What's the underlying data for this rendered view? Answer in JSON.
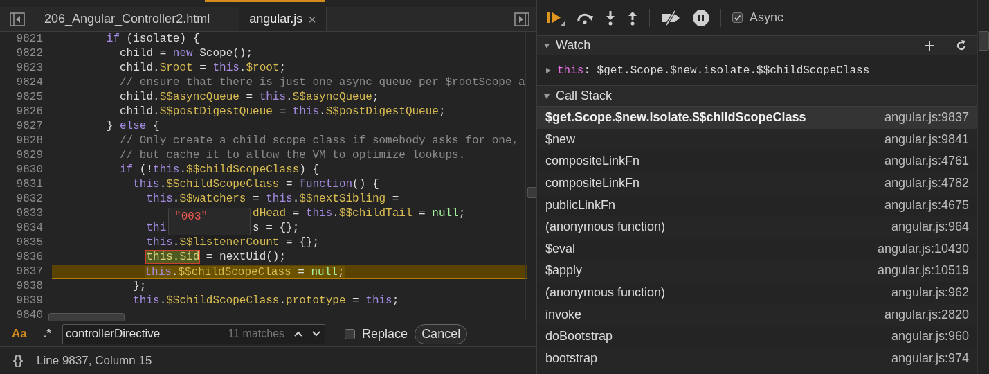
{
  "editor": {
    "tabs": [
      {
        "label": "206_Angular_Controller2.html",
        "selected": false
      },
      {
        "label": "angular.js",
        "close": "×",
        "selected": true
      }
    ],
    "code_lines": [
      {
        "number": "9821",
        "current": false,
        "tokens": [
          {
            "kind": "k",
            "text": "        if"
          },
          {
            "kind": "p",
            "text": " (isolate) {"
          }
        ]
      },
      {
        "number": "9822",
        "current": false,
        "tokens": [
          {
            "kind": "p",
            "text": "          child = "
          },
          {
            "kind": "k",
            "text": "new"
          },
          {
            "kind": "p",
            "text": " Scope();"
          }
        ]
      },
      {
        "number": "9823",
        "current": false,
        "tokens": [
          {
            "kind": "p",
            "text": "          child."
          },
          {
            "kind": "v",
            "text": "$root"
          },
          {
            "kind": "p",
            "text": " = "
          },
          {
            "kind": "k",
            "text": "this"
          },
          {
            "kind": "p",
            "text": "."
          },
          {
            "kind": "v",
            "text": "$root"
          },
          {
            "kind": "p",
            "text": ";"
          }
        ]
      },
      {
        "number": "9824",
        "current": false,
        "tokens": [
          {
            "kind": "c",
            "text": "          // ensure that there is just one async queue per $rootScope a"
          }
        ]
      },
      {
        "number": "9825",
        "current": false,
        "tokens": [
          {
            "kind": "p",
            "text": "          child."
          },
          {
            "kind": "v",
            "text": "$$asyncQueue"
          },
          {
            "kind": "p",
            "text": " = "
          },
          {
            "kind": "k",
            "text": "this"
          },
          {
            "kind": "p",
            "text": "."
          },
          {
            "kind": "v",
            "text": "$$asyncQueue"
          },
          {
            "kind": "p",
            "text": ";"
          }
        ]
      },
      {
        "number": "9826",
        "current": false,
        "tokens": [
          {
            "kind": "p",
            "text": "          child."
          },
          {
            "kind": "v",
            "text": "$$postDigestQueue"
          },
          {
            "kind": "p",
            "text": " = "
          },
          {
            "kind": "k",
            "text": "this"
          },
          {
            "kind": "p",
            "text": "."
          },
          {
            "kind": "v",
            "text": "$$postDigestQueue"
          },
          {
            "kind": "p",
            "text": ";"
          }
        ]
      },
      {
        "number": "9827",
        "current": false,
        "tokens": [
          {
            "kind": "p",
            "text": "        } "
          },
          {
            "kind": "k",
            "text": "else"
          },
          {
            "kind": "p",
            "text": " {"
          }
        ]
      },
      {
        "number": "9828",
        "current": false,
        "tokens": [
          {
            "kind": "c",
            "text": "          // Only create a child scope class if somebody asks for one,"
          }
        ]
      },
      {
        "number": "9829",
        "current": false,
        "tokens": [
          {
            "kind": "c",
            "text": "          // but cache it to allow the VM to optimize lookups."
          }
        ]
      },
      {
        "number": "9830",
        "current": false,
        "tokens": [
          {
            "kind": "k",
            "text": "          if"
          },
          {
            "kind": "p",
            "text": " (!"
          },
          {
            "kind": "k",
            "text": "this"
          },
          {
            "kind": "p",
            "text": "."
          },
          {
            "kind": "v",
            "text": "$$childScopeClass"
          },
          {
            "kind": "p",
            "text": ") {"
          }
        ]
      },
      {
        "number": "9831",
        "current": false,
        "tokens": [
          {
            "kind": "k",
            "text": "            this"
          },
          {
            "kind": "p",
            "text": "."
          },
          {
            "kind": "v",
            "text": "$$childScopeClass"
          },
          {
            "kind": "p",
            "text": " = "
          },
          {
            "kind": "k",
            "text": "function"
          },
          {
            "kind": "p",
            "text": "() {"
          }
        ]
      },
      {
        "number": "9832",
        "current": false,
        "tokens": [
          {
            "kind": "k",
            "text": "              this"
          },
          {
            "kind": "p",
            "text": "."
          },
          {
            "kind": "v",
            "text": "$$watchers"
          },
          {
            "kind": "p",
            "text": " = "
          },
          {
            "kind": "k",
            "text": "this"
          },
          {
            "kind": "p",
            "text": "."
          },
          {
            "kind": "v",
            "text": "$$nextSibling"
          },
          {
            "kind": "p",
            "text": " ="
          }
        ]
      },
      {
        "number": "9833",
        "current": false,
        "tokens": [
          {
            "kind": "v",
            "text": "                              dHead"
          },
          {
            "kind": "p",
            "text": " = "
          },
          {
            "kind": "k",
            "text": "this"
          },
          {
            "kind": "p",
            "text": "."
          },
          {
            "kind": "v",
            "text": "$$childTail"
          },
          {
            "kind": "p",
            "text": " = "
          },
          {
            "kind": "n",
            "text": "null"
          },
          {
            "kind": "p",
            "text": ";"
          }
        ]
      },
      {
        "number": "9834",
        "current": false,
        "tokens": [
          {
            "kind": "k",
            "text": "              thi"
          },
          {
            "kind": "p",
            "text": "             s = {};"
          }
        ]
      },
      {
        "number": "9835",
        "current": false,
        "tokens": [
          {
            "kind": "k",
            "text": "              this"
          },
          {
            "kind": "p",
            "text": "."
          },
          {
            "kind": "v",
            "text": "$$listenerCount"
          },
          {
            "kind": "p",
            "text": " = {};"
          }
        ]
      },
      {
        "number": "9836",
        "current": false,
        "tokens": [
          {
            "kind": "m",
            "text": "              this.$id"
          },
          {
            "kind": "p",
            "text": " = nextUid();"
          }
        ]
      },
      {
        "number": "9837",
        "current": true,
        "tokens": [
          {
            "kind": "k",
            "text": "              this"
          },
          {
            "kind": "p",
            "text": "."
          },
          {
            "kind": "v",
            "text": "$$childScopeClass"
          },
          {
            "kind": "p",
            "text": " = "
          },
          {
            "kind": "n",
            "text": "null"
          },
          {
            "kind": "p",
            "text": ";"
          }
        ]
      },
      {
        "number": "9838",
        "current": false,
        "tokens": [
          {
            "kind": "p",
            "text": "            };"
          }
        ]
      },
      {
        "number": "9839",
        "current": false,
        "tokens": [
          {
            "kind": "k",
            "text": "            this"
          },
          {
            "kind": "p",
            "text": "."
          },
          {
            "kind": "v",
            "text": "$$childScopeClass"
          },
          {
            "kind": "p",
            "text": "."
          },
          {
            "kind": "v",
            "text": "prototype"
          },
          {
            "kind": "p",
            "text": " = "
          },
          {
            "kind": "k",
            "text": "this"
          },
          {
            "kind": "p",
            "text": ";"
          }
        ]
      },
      {
        "number": "9840",
        "current": false
      }
    ],
    "tooltip": "\"003\"",
    "search": {
      "case_toggle": "Aa",
      "regex_toggle": ".*",
      "value": "controllerDirective",
      "matches": "11 matches",
      "replace": {
        "label": "Replace",
        "checked": false
      },
      "cancel": "Cancel"
    },
    "status_bar": {
      "pretty_print": "{}",
      "position": "Line 9837, Column 15"
    }
  },
  "debugger": {
    "async": {
      "label": "Async",
      "checked": true
    },
    "watch": {
      "title": "Watch",
      "expanded": true,
      "items": [
        {
          "name": "this",
          "separator": ":",
          "value": "$get.Scope.$new.isolate.$$childScopeClass",
          "expanded": false
        }
      ]
    },
    "call_stack": {
      "title": "Call Stack",
      "expanded": true,
      "frames": [
        {
          "name": "$get.Scope.$new.isolate.$$childScopeClass",
          "location": "angular.js:9837",
          "selected": true
        },
        {
          "name": "$new",
          "location": "angular.js:9841",
          "selected": false
        },
        {
          "name": "compositeLinkFn",
          "location": "angular.js:4761",
          "selected": false
        },
        {
          "name": "compositeLinkFn",
          "location": "angular.js:4782",
          "selected": false
        },
        {
          "name": "publicLinkFn",
          "location": "angular.js:4675",
          "selected": false
        },
        {
          "name": "(anonymous function)",
          "location": "angular.js:964",
          "selected": false
        },
        {
          "name": "$eval",
          "location": "angular.js:10430",
          "selected": false
        },
        {
          "name": "$apply",
          "location": "angular.js:10519",
          "selected": false
        },
        {
          "name": "(anonymous function)",
          "location": "angular.js:962",
          "selected": false
        },
        {
          "name": "invoke",
          "location": "angular.js:2820",
          "selected": false
        },
        {
          "name": "doBootstrap",
          "location": "angular.js:960",
          "selected": false
        },
        {
          "name": "bootstrap",
          "location": "angular.js:974",
          "selected": false
        }
      ]
    }
  }
}
